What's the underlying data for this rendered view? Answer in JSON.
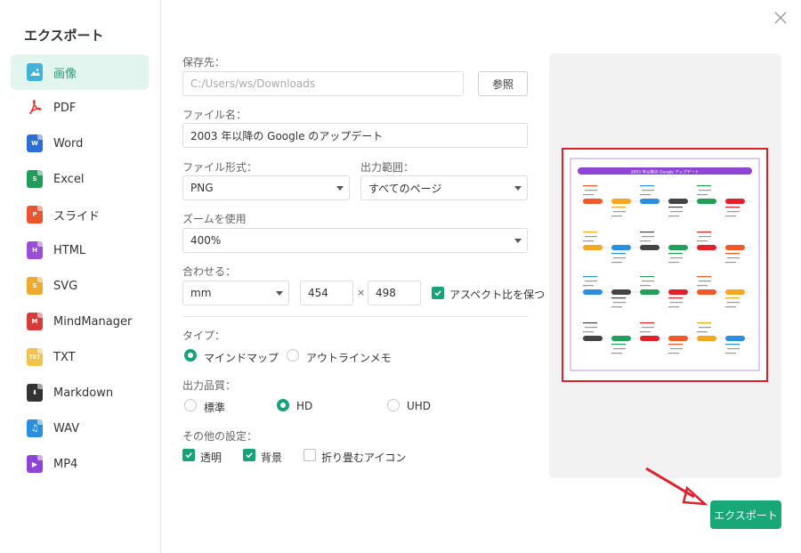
{
  "sidebar": {
    "title": "エクスポート",
    "items": [
      {
        "label": "画像",
        "icon": "image-icon",
        "color": "#3fb3d9",
        "tag": ""
      },
      {
        "label": "PDF",
        "icon": "pdf-icon",
        "color": "#e53935",
        "tag": ""
      },
      {
        "label": "Word",
        "icon": "word-icon",
        "color": "#2b6fd6",
        "tag": "W"
      },
      {
        "label": "Excel",
        "icon": "excel-icon",
        "color": "#1e9e5a",
        "tag": "S"
      },
      {
        "label": "スライド",
        "icon": "slide-icon",
        "color": "#e8552f",
        "tag": "P"
      },
      {
        "label": "HTML",
        "icon": "html-icon",
        "color": "#9c4fd6",
        "tag": "H"
      },
      {
        "label": "SVG",
        "icon": "svg-icon",
        "color": "#f0a830",
        "tag": "S"
      },
      {
        "label": "MindManager",
        "icon": "mindmanager-icon",
        "color": "#d93b3b",
        "tag": "M"
      },
      {
        "label": "TXT",
        "icon": "txt-icon",
        "color": "#f2c14e",
        "tag": "TXT"
      },
      {
        "label": "Markdown",
        "icon": "markdown-icon",
        "color": "#333333",
        "tag": "⬇"
      },
      {
        "label": "WAV",
        "icon": "wav-icon",
        "color": "#2b8fe0",
        "tag": "♫"
      },
      {
        "label": "MP4",
        "icon": "mp4-icon",
        "color": "#8e44d6",
        "tag": "▶"
      }
    ]
  },
  "form": {
    "save_label": "保存先：",
    "save_path": "C:/Users/ws/Downloads",
    "browse_label": "参照",
    "filename_label": "ファイル名：",
    "filename_value": "2003 年以降の Google のアップデート",
    "format_label": "ファイル形式：",
    "format_value": "PNG",
    "range_label": "出力範囲：",
    "range_value": "すべてのページ",
    "zoom_label": "ズームを使用",
    "zoom_value": "400%",
    "fit_label": "合わせる：",
    "unit_value": "mm",
    "width_value": "454",
    "times": "×",
    "height_value": "498",
    "aspect_label": "アスペクト比を保つ",
    "type_label": "タイプ：",
    "type_mindmap": "マインドマップ",
    "type_outline": "アウトラインメモ",
    "quality_label": "出力品質：",
    "quality_standard": "標準",
    "quality_hd": "HD",
    "quality_uhd": "UHD",
    "other_label": "その他の設定：",
    "opt_transparent": "透明",
    "opt_background": "背景",
    "opt_collapse": "折り畳むアイコン"
  },
  "preview": {
    "title": "2003 年以降の Google アップデート"
  },
  "export_label": "エクスポート",
  "colors": {
    "accent": "#16a37a",
    "highlight": "#e0202a"
  }
}
